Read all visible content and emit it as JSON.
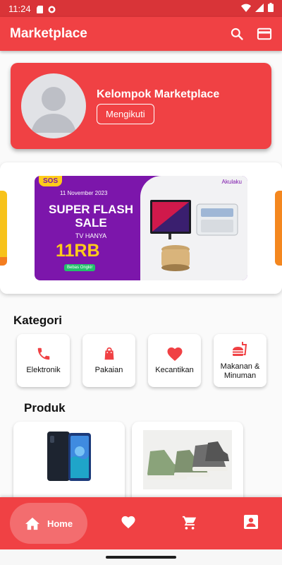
{
  "status_bar": {
    "time": "11:24",
    "icons": [
      "sd-card-icon",
      "notification-icon",
      "wifi-icon",
      "signal-icon",
      "battery-icon"
    ]
  },
  "app_bar": {
    "title": "Marketplace",
    "actions": [
      "search-icon",
      "card-icon"
    ]
  },
  "profile": {
    "name": "Kelompok Marketplace",
    "follow_label": "Mengikuti"
  },
  "banner": {
    "sos": "SOS",
    "date": "11 November 2023",
    "headline": "SUPER FLASH SALE",
    "subtitle": "TV HANYA",
    "price": "11RB",
    "badge": "Bebas Ongkir",
    "brand": "Akulaku"
  },
  "categories": {
    "title": "Kategori",
    "items": [
      {
        "label": "Elektronik",
        "icon": "phone-icon"
      },
      {
        "label": "Pakaian",
        "icon": "shopping-bag-icon"
      },
      {
        "label": "Kecantikan",
        "icon": "heart-icon"
      },
      {
        "label": "Makanan & Minuman",
        "icon": "fastfood-icon"
      }
    ]
  },
  "products": {
    "title": "Produk"
  },
  "bottom_nav": {
    "home_label": "Home",
    "items": [
      "home-icon",
      "favorite-icon",
      "cart-icon",
      "account-icon"
    ]
  },
  "colors": {
    "primary": "#f04144",
    "status_bar": "#d93438",
    "active_pill": "#f36d6f",
    "banner_purple": "#7c16ab"
  }
}
